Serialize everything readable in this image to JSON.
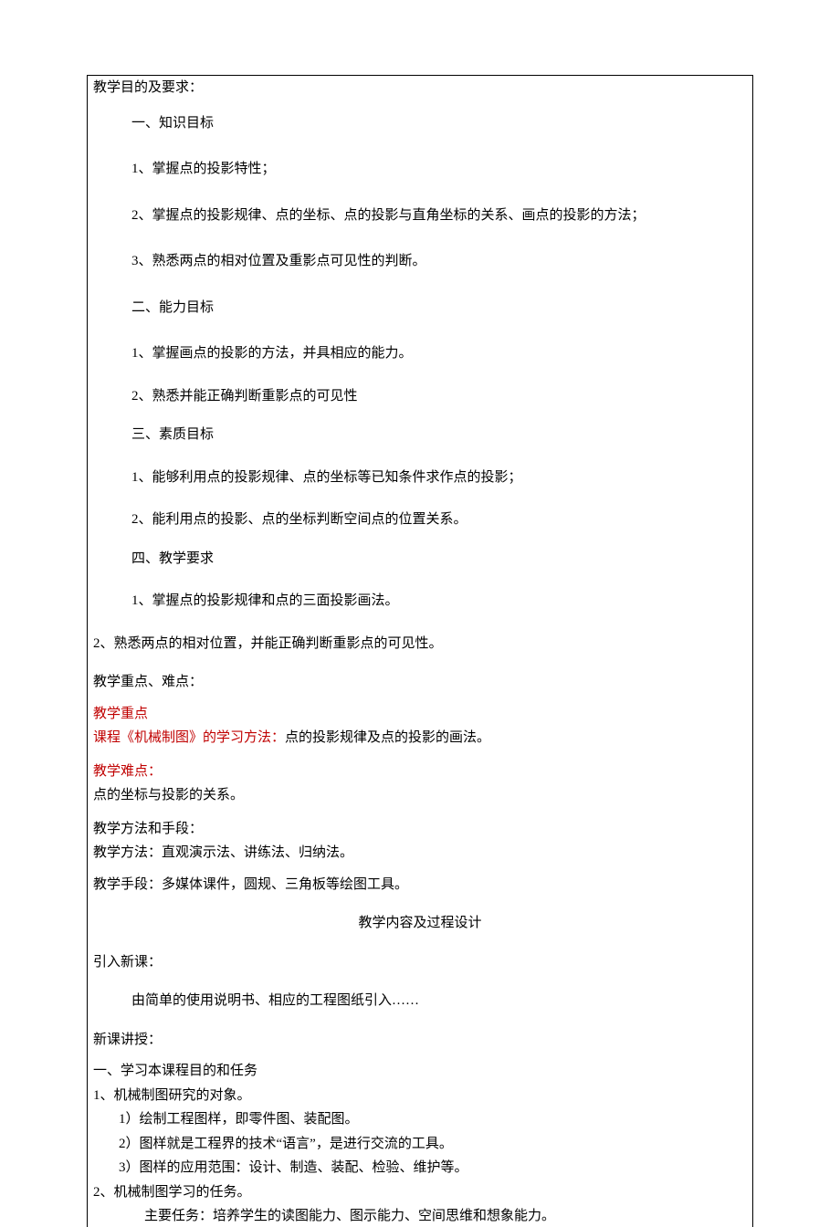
{
  "heading_objectives": "教学目的及要求：",
  "goal_knowledge": "一、知识目标",
  "gk1": "1、掌握点的投影特性；",
  "gk2": "2、掌握点的投影规律、点的坐标、点的投影与直角坐标的关系、画点的投影的方法；",
  "gk3": "3、熟悉两点的相对位置及重影点可见性的判断。",
  "goal_ability": "二、能力目标",
  "ga1": "1、掌握画点的投影的方法，并具相应的能力。",
  "ga2": "2、熟悉并能正确判断重影点的可见性",
  "goal_quality": "三、素质目标",
  "gq1": "1、能够利用点的投影规律、点的坐标等已知条件求作点的投影；",
  "gq2": "2、能利用点的投影、点的坐标判断空间点的位置关系。",
  "goal_req": "四、教学要求",
  "gr1": "1、掌握点的投影规律和点的三面投影画法。",
  "gr2": "2、熟悉两点的相对位置，并能正确判断重影点的可见性。",
  "heading_focus": "教学重点、难点：",
  "focus_label": "教学重点",
  "focus_method_prefix": "课程《机械制图》的学习方法：",
  "focus_method_text": "点的投影规律及点的投影的画法。",
  "difficulty_label": "教学难点：",
  "difficulty_text": "点的坐标与投影的关系。",
  "method_heading": "教学方法和手段：",
  "method_line": "教学方法：直观演示法、讲练法、归纳法。",
  "means_line": "教学手段：多媒体课件，圆规、三角板等绘图工具。",
  "process_heading": "教学内容及过程设计",
  "intro_heading": "引入新课：",
  "intro_line": "由简单的使用说明书、相应的工程图纸引入……",
  "lecture_heading": "新课讲授：",
  "s1": "一、学习本课程目的和任务",
  "s1_1": "1、机械制图研究的对象。",
  "s1_1a": "1）绘制工程图样，即零件图、装配图。",
  "s1_1b": "2）图样就是工程界的技术“语言”，是进行交流的工具。",
  "s1_1c": "3）图样的应用范围：设计、制造、装配、检验、维护等。",
  "s1_2": "2、机械制图学习的任务。",
  "s1_2a": "主要任务：培养学生的读图能力、图示能力、空间思维和想象能力。"
}
